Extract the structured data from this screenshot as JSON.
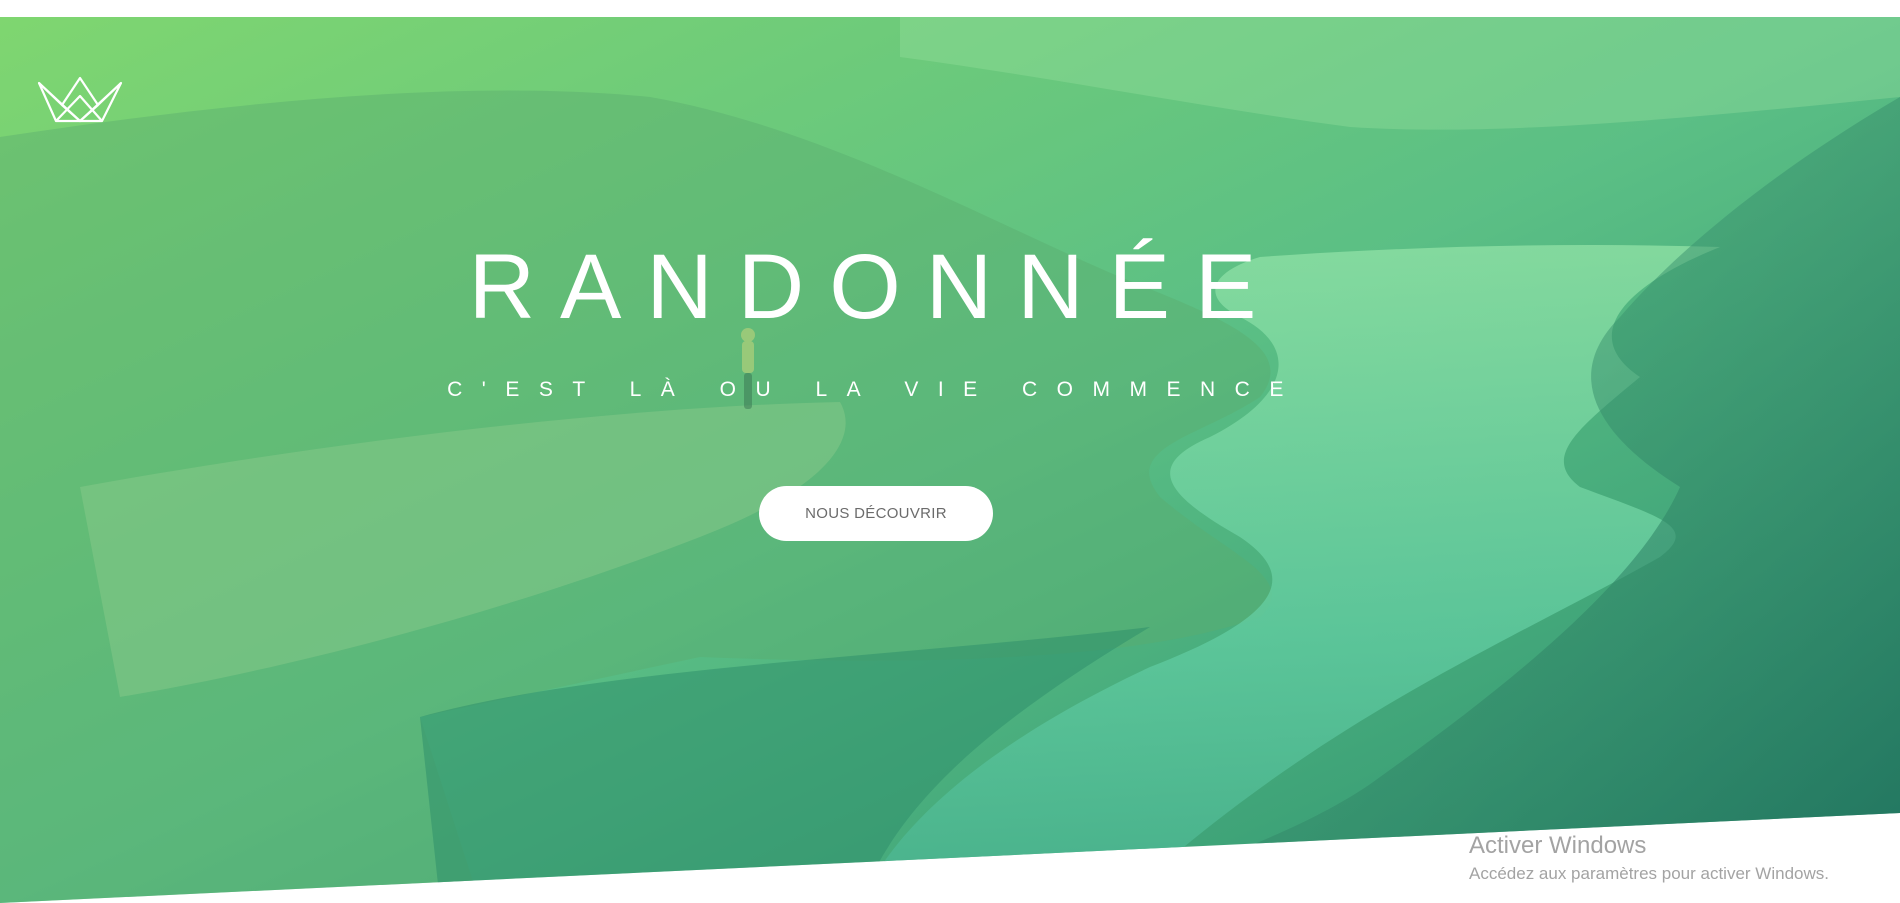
{
  "hero": {
    "title": "RANDONNÉE",
    "subtitle": "C'EST LÀ OU LA VIE COMMENCE",
    "cta_label": "NOUS DÉCOUVRIR",
    "logo_icon": "crown-icon",
    "background": "mountain-fjord-photo",
    "gradient_colors": {
      "top_left": "#7ed56f",
      "bottom_right": "#28b485"
    }
  },
  "os_watermark": {
    "title": "Activer Windows",
    "subtitle": "Accédez aux paramètres pour activer Windows."
  }
}
